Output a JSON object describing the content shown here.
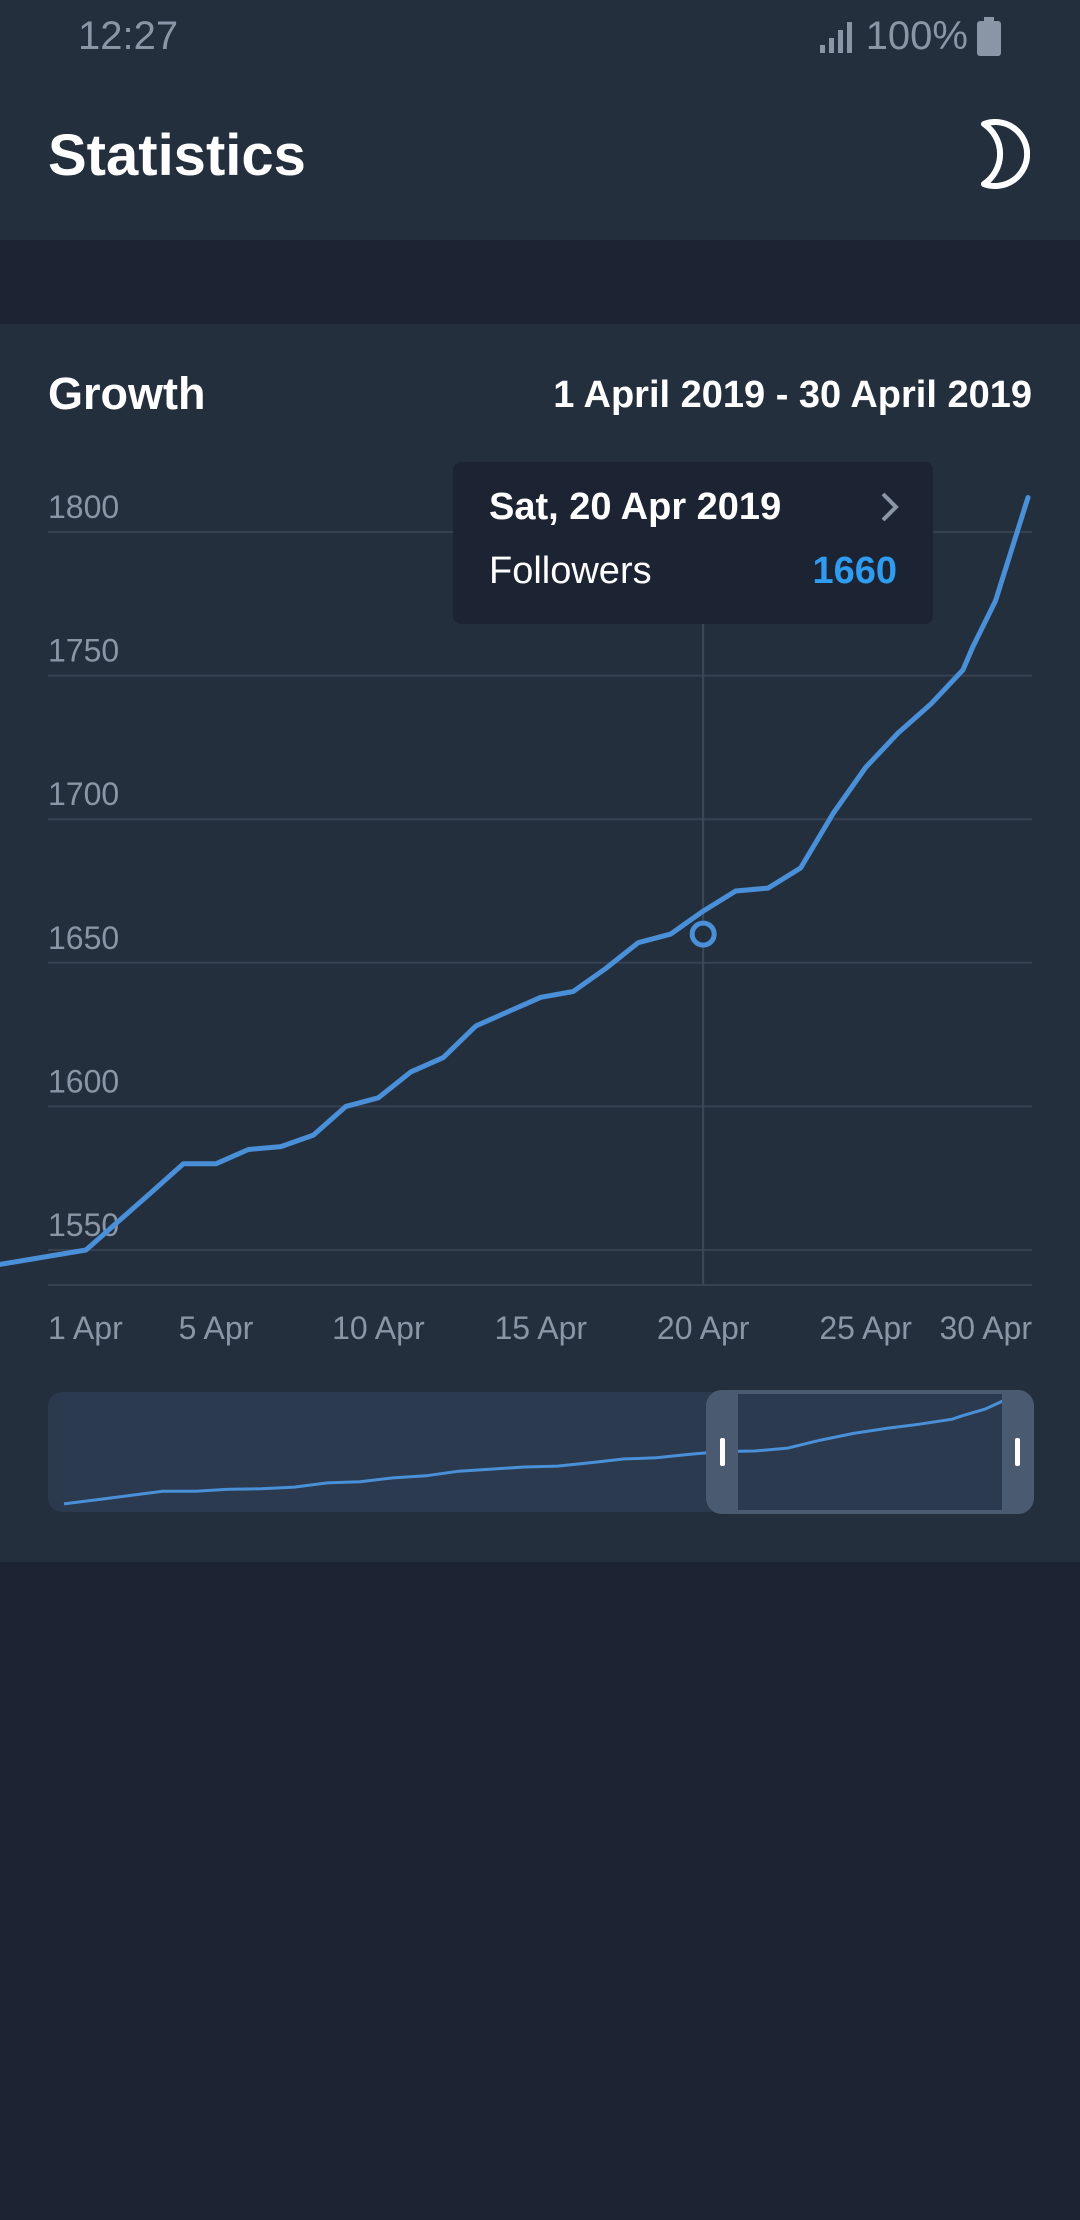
{
  "status_bar": {
    "time": "12:27",
    "battery": "100%",
    "icons": [
      "signal-icon",
      "battery-icon"
    ]
  },
  "app_bar": {
    "title": "Statistics",
    "night_mode_icon": "moon-icon"
  },
  "card": {
    "title": "Growth",
    "date_range": "1 April 2019 - 30 April 2019"
  },
  "tooltip": {
    "date": "Sat, 20 Apr 2019",
    "label": "Followers",
    "value": "1660",
    "chevron_icon": "chevron-right-icon"
  },
  "colors": {
    "background": "#1c2333",
    "card": "#242f3e",
    "line": "#4a90d9",
    "tooltip_value": "#2f9cf0",
    "grid": "#364152",
    "muted_text": "#8a96a6"
  },
  "chart_data": {
    "type": "line",
    "title": "",
    "xlabel": "",
    "ylabel": "",
    "ylim": [
      1545,
      1812
    ],
    "y_ticks": [
      1550,
      1600,
      1650,
      1700,
      1750,
      1800
    ],
    "x_ticks": [
      {
        "day": 1,
        "label": "1 Apr"
      },
      {
        "day": 5,
        "label": "5 Apr"
      },
      {
        "day": 10,
        "label": "10 Apr"
      },
      {
        "day": 15,
        "label": "15 Apr"
      },
      {
        "day": 20,
        "label": "20 Apr"
      },
      {
        "day": 25,
        "label": "25 Apr"
      },
      {
        "day": 30,
        "label": "30 Apr"
      }
    ],
    "grid": true,
    "highlight_day": 20,
    "highlight_value": 1660,
    "series": [
      {
        "x": [
          1,
          2,
          3,
          4,
          5,
          6,
          7,
          8,
          9,
          10,
          11,
          12,
          13,
          14,
          15,
          16,
          17,
          18,
          19,
          20,
          21,
          22,
          23,
          24,
          25,
          26,
          27,
          28,
          28.3,
          29,
          30
        ],
        "values": [
          1550,
          1560,
          1570,
          1580,
          1580,
          1585,
          1586,
          1590,
          1600,
          1603,
          1612,
          1617,
          1628,
          1633,
          1638,
          1640,
          1648,
          1657,
          1660,
          1668,
          1675,
          1676,
          1683,
          1702,
          1718,
          1730,
          1740,
          1752,
          1760,
          1776,
          1812
        ]
      }
    ]
  }
}
